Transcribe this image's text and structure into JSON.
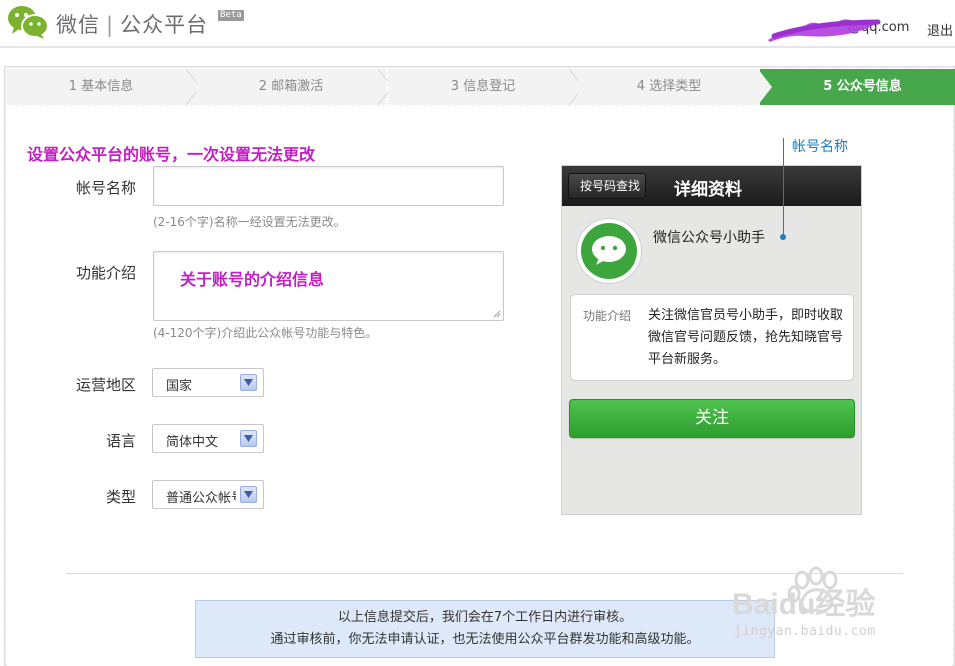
{
  "header": {
    "logo_text": "微信",
    "logo_separator": "|",
    "product_name": "公众平台",
    "badge": "Beta",
    "user_email_suffix": "@qq.com",
    "logout_label": "退出"
  },
  "steps": [
    {
      "label": "1 基本信息",
      "active": false
    },
    {
      "label": "2 邮箱激活",
      "active": false
    },
    {
      "label": "3 信息登记",
      "active": false
    },
    {
      "label": "4 选择类型",
      "active": false
    },
    {
      "label": "5 公众号信息",
      "active": true
    }
  ],
  "form": {
    "hint_title": "设置公众平台的账号，一次设置无法更改",
    "account_name": {
      "label": "帐号名称",
      "value": "",
      "helper": "(2-16个字)名称一经设置无法更改。"
    },
    "intro": {
      "label": "功能介绍",
      "value": "关于账号的介绍信息",
      "helper": "(4-120个字)介绍此公众帐号功能与特色。"
    },
    "region": {
      "label": "运营地区",
      "value": "国家"
    },
    "language": {
      "label": "语言",
      "value": "简体中文"
    },
    "type": {
      "label": "类型",
      "value": "普通公众帐号"
    }
  },
  "preview": {
    "back_label": "按号码查找",
    "title": "详细资料",
    "account_name": "微信公众号小助手",
    "intro_label": "功能介绍",
    "intro_text": "关注微信官员号小助手，即时收取微信官号问题反馈，抢先知晓官号平台新服务。",
    "follow_label": "关注",
    "callout": "帐号名称"
  },
  "notice": {
    "line1": "以上信息提交后，我们会在7个工作日内进行审核。",
    "line2": "通过审核前，你无法申请认证，也无法使用公众平台群发功能和高级功能。"
  },
  "watermark": {
    "brand": "Baidu经验",
    "url": "jingyan.baidu.com"
  },
  "colors": {
    "accent_green": "#46a84a",
    "hint_magenta": "#c21fc2",
    "callout_blue": "#1b7ec0",
    "follow_green": "#3db03d"
  }
}
